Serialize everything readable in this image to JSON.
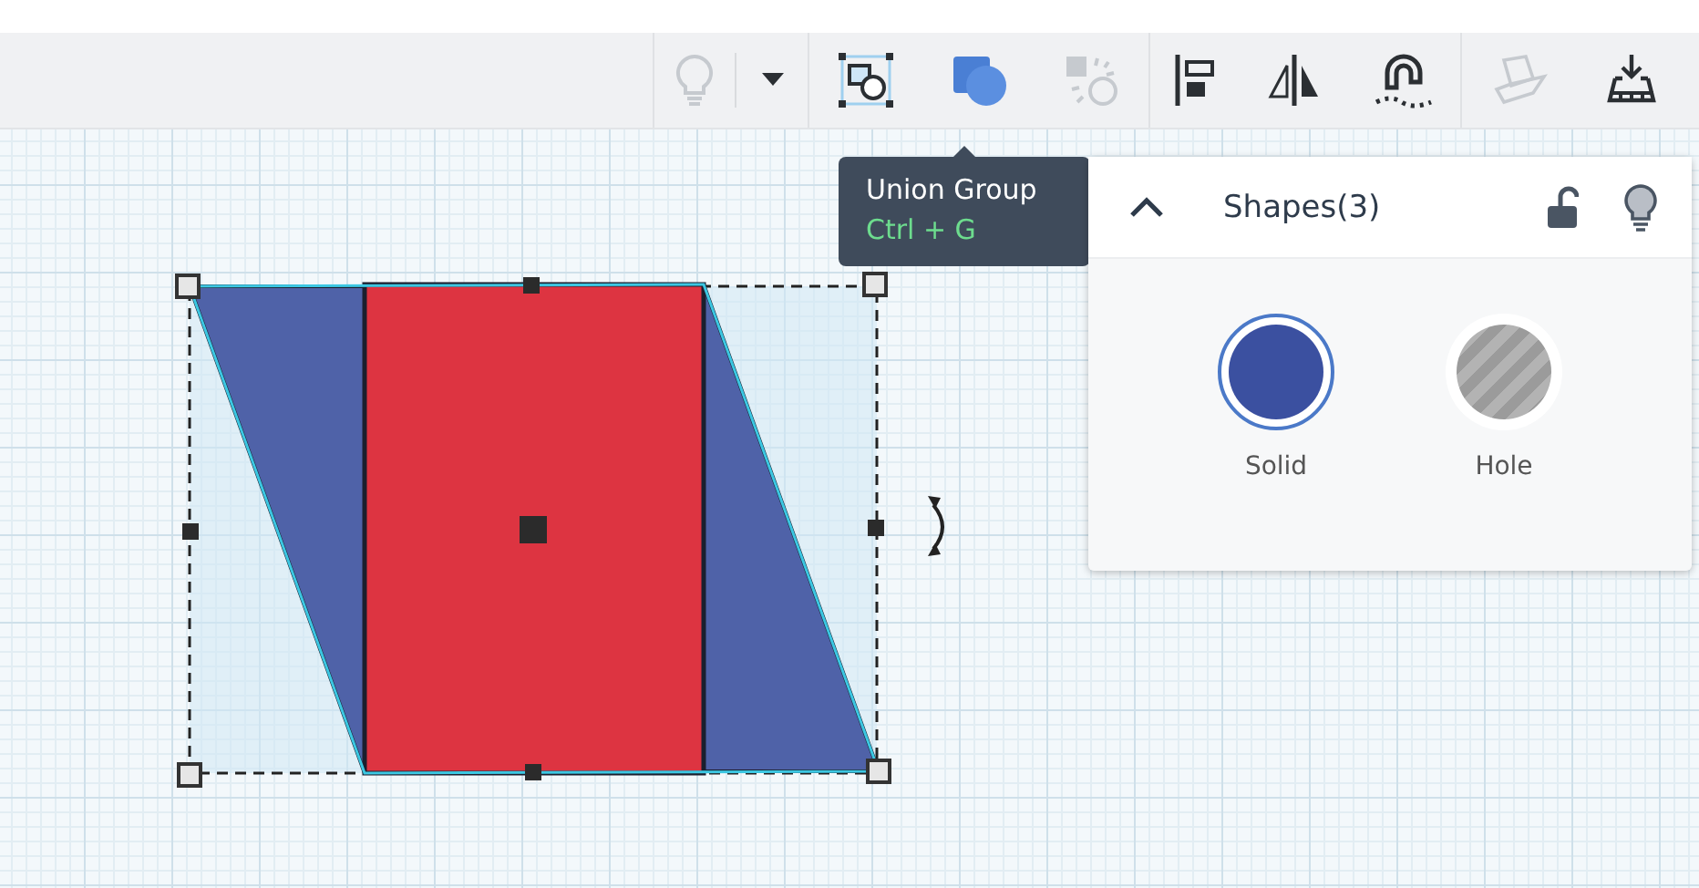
{
  "toolbar": {
    "groups": [
      {
        "buttons": [
          {
            "kind": "light",
            "disabled": true
          },
          {
            "kind": "dropdown",
            "disabled": false
          }
        ]
      },
      {
        "buttons": [
          {
            "kind": "group",
            "disabled": false
          },
          {
            "kind": "union",
            "disabled": false
          },
          {
            "kind": "ungroup",
            "disabled": true
          }
        ]
      },
      {
        "buttons": [
          {
            "kind": "align",
            "disabled": false
          },
          {
            "kind": "mirror",
            "disabled": false
          },
          {
            "kind": "magnet",
            "disabled": false
          }
        ]
      },
      {
        "buttons": [
          {
            "kind": "workplane",
            "disabled": true
          },
          {
            "kind": "drop",
            "disabled": false
          }
        ]
      }
    ]
  },
  "tooltip": {
    "title": "Union Group",
    "shortcut": "Ctrl + G"
  },
  "shapes_panel": {
    "title": "Shapes(3)",
    "expanded": true,
    "locked": false,
    "options": [
      {
        "label": "Solid",
        "kind": "solid",
        "selected": true
      },
      {
        "label": "Hole",
        "kind": "hole",
        "selected": false
      }
    ]
  }
}
